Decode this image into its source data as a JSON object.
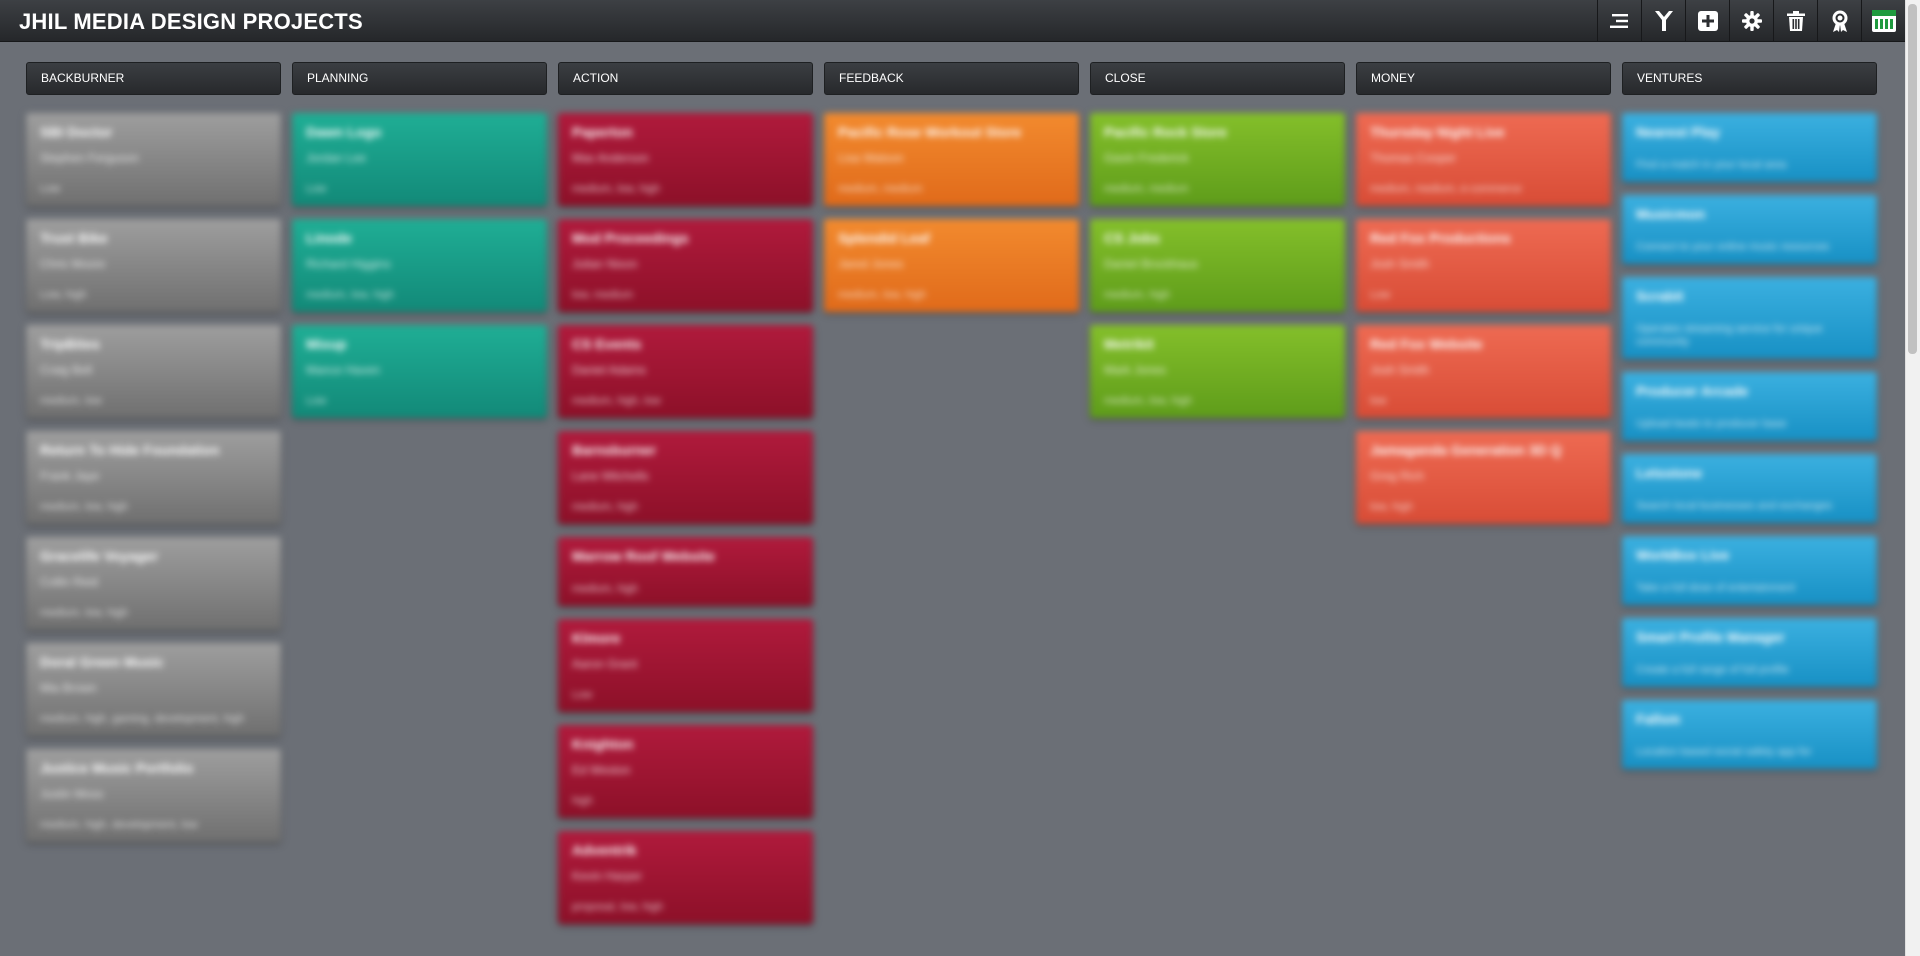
{
  "app": {
    "title": "JHIL MEDIA DESIGN PROJECTS"
  },
  "toolbar": [
    {
      "icon": "list-icon"
    },
    {
      "icon": "filter-icon"
    },
    {
      "icon": "add-card-icon"
    },
    {
      "icon": "gear-icon"
    },
    {
      "icon": "trash-icon"
    },
    {
      "icon": "award-icon"
    },
    {
      "icon": "logo-icon"
    }
  ],
  "columns": [
    {
      "name": "BACKBURNER",
      "color": "grey",
      "cards": [
        {
          "title": "SBI Doctor",
          "sub": "Stephen Ferguson",
          "meta": "Low"
        },
        {
          "title": "Trust Bike",
          "sub": "Chris Moore",
          "meta": "Low, high"
        },
        {
          "title": "TripBites",
          "sub": "Craig Bell",
          "meta": "medium, low"
        },
        {
          "title": "Return To Hide Foundation",
          "sub": "Frank Jaye",
          "meta": "medium, low, high"
        },
        {
          "title": "Gracelife Voyager",
          "sub": "Collin Reid",
          "meta": "medium, low, high"
        },
        {
          "title": "Doral Green Music",
          "sub": "Mia Brown",
          "meta": "medium, high, gaming, development, high"
        },
        {
          "title": "Justice Music Portfolio",
          "sub": "Justin Moss",
          "meta": "medium, high, development, low"
        }
      ]
    },
    {
      "name": "PLANNING",
      "color": "teal",
      "cards": [
        {
          "title": "Dawn Logo",
          "sub": "Jordan Lee",
          "meta": "Low"
        },
        {
          "title": "Linode",
          "sub": "Richard Higgins",
          "meta": "medium, low, high"
        },
        {
          "title": "Mixup",
          "sub": "Mance Haven",
          "meta": "Low"
        }
      ]
    },
    {
      "name": "ACTION",
      "color": "red",
      "cards": [
        {
          "title": "Paperton",
          "sub": "Max Anderson",
          "meta": "medium, low, high"
        },
        {
          "title": "Mod Proceedings",
          "sub": "Julian Nixon",
          "meta": "low, medium"
        },
        {
          "title": "CS Events",
          "sub": "Daniel Adams",
          "meta": "medium, high, low"
        },
        {
          "title": "Barnsburner",
          "sub": "Lane Mitchells",
          "meta": "medium, high"
        },
        {
          "title": "Marrow Roof Website",
          "sub": "",
          "meta": "medium, high"
        },
        {
          "title": "Klmore",
          "sub": "Aaron Grant",
          "meta": "Low"
        },
        {
          "title": "Knighton",
          "sub": "Ed Weston",
          "meta": "high"
        },
        {
          "title": "Adventrik",
          "sub": "Kevin Harper",
          "meta": "proposal, low, high"
        }
      ]
    },
    {
      "name": "FEEDBACK",
      "color": "orange",
      "cards": [
        {
          "title": "Pacific Rose Workout Store",
          "sub": "Lisa Watson",
          "meta": "medium, medium"
        },
        {
          "title": "Splendid Leaf",
          "sub": "Jared Jones",
          "meta": "medium, low, high"
        }
      ]
    },
    {
      "name": "CLOSE",
      "color": "green",
      "cards": [
        {
          "title": "Pacific Rock Store",
          "sub": "Gavin Frederick",
          "meta": "medium, medium"
        },
        {
          "title": "CS Jobs",
          "sub": "Daniel Brockhaus",
          "meta": "medium, high"
        },
        {
          "title": "Metrikit",
          "sub": "Mark Jones",
          "meta": "medium, low, high"
        }
      ]
    },
    {
      "name": "MONEY",
      "color": "salmon",
      "cards": [
        {
          "title": "Thursday Night Live",
          "sub": "Thomas Cooper",
          "meta": "medium, medium, e-commerce"
        },
        {
          "title": "Red Fox Productions",
          "sub": "Josh Smith",
          "meta": "Low"
        },
        {
          "title": "Red Fox Website",
          "sub": "Josh Smith",
          "meta": "low"
        },
        {
          "title": "Jamaganda Generation 3D Q",
          "sub": "Greg Rich",
          "meta": "low, high"
        }
      ]
    },
    {
      "name": "VENTURES",
      "color": "blue",
      "cards": [
        {
          "title": "Nearest Play",
          "sub": "",
          "meta": "Find a match in your local area"
        },
        {
          "title": "Musicmon",
          "sub": "",
          "meta": "Connect to your online music resources"
        },
        {
          "title": "Scrabit",
          "sub": "",
          "meta": "Operates streaming service for unique community"
        },
        {
          "title": "Producer Arcade",
          "sub": "",
          "meta": "Upload beats to producer base"
        },
        {
          "title": "Letsstone",
          "sub": "",
          "meta": "Search local businesses and exchanges"
        },
        {
          "title": "WorkBox Live",
          "sub": "",
          "meta": "Take a full dose of entertainment"
        },
        {
          "title": "Smart Profile Manager",
          "sub": "",
          "meta": "Create a full range of full profile"
        },
        {
          "title": "Fallsm",
          "sub": "",
          "meta": "Location based social safety app for"
        }
      ]
    }
  ]
}
